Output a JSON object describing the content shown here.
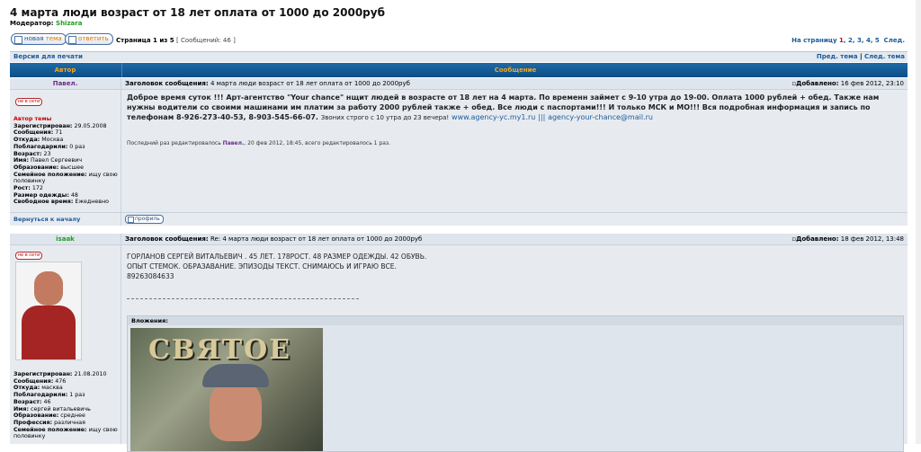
{
  "page": {
    "title": "4 марта люди возраст от 18 лет оплата от 1000 до 2000руб",
    "moderator_label": "Модератор:",
    "moderator_name": "Shizara"
  },
  "toolbar": {
    "new_topic_prefix": "новая",
    "new_topic_suffix": "тема",
    "reply_label": "ответить",
    "page_label": "Страница 1 из 5",
    "messages_count": "[ Сообщений: 46 ]",
    "goto_label": "На страницу",
    "pages": [
      "1",
      "2",
      "3",
      "4",
      "5"
    ],
    "next_label": "След."
  },
  "nav": {
    "print_version": "Версия для печати",
    "prev_topic": "Пред. тема",
    "separator": "|",
    "next_topic": "След. тема"
  },
  "table_header": {
    "author": "Автор",
    "message": "Сообщение"
  },
  "posts": [
    {
      "author": "Павел.",
      "online_label": "не в сети",
      "topic_starter": "Автор темы",
      "subject_label": "Заголовок сообщения:",
      "subject": "4 марта люди возраст от 18 лет оплата от 1000 до 2000руб",
      "added_label": "Добавлено:",
      "added": "16 фев 2012, 23:10",
      "profile": [
        {
          "k": "Зарегистрирован:",
          "v": "29.05.2008"
        },
        {
          "k": "Сообщения:",
          "v": "71"
        },
        {
          "k": "Откуда:",
          "v": "Москва"
        },
        {
          "k": "Поблагодарили:",
          "v": "0 раз"
        },
        {
          "k": "Возраст:",
          "v": "23"
        },
        {
          "k": "Имя:",
          "v": "Павел Сергеевич"
        },
        {
          "k": "Образование:",
          "v": "высшее"
        },
        {
          "k": "Семейное положение:",
          "v": "ищу свою половинку"
        },
        {
          "k": "Рост:",
          "v": "172"
        },
        {
          "k": "Размер одежды:",
          "v": "48"
        },
        {
          "k": "Свободное время:",
          "v": "Ежедневно"
        }
      ],
      "body_main": "Доброе время суток !!! Арт-агентство \"Your chance\" нщит людей в возрасте от 18 лет на 4 марта. По временн займет с 9-10 утра до 19-00. Оплата 1000 рублей + обед. Также нам нужны водители со своими машинами им платим за работу 2000 рублей также + обед. Все люди с паспортами!!! И только МСК и МО!!! Вся подробная информация и запись по телефонам 8-926-273-40-53, 8-903-545-66-07.",
      "body_tail": "Звоних строго с 10 утра до 23 вечера!",
      "link1": "www.agency-yc.my1.ru",
      "link_sep": "|||",
      "link2": "agency-your-chance@mail.ru",
      "edited_prefix": "Последний раз редактировалось",
      "edited_by": "Павел.",
      "edited_suffix": "20 фев 2012, 18:45, всего редактировалось 1 раз.",
      "back_to_top": "Вернуться к началу",
      "profile_button": "профиль"
    },
    {
      "author": "isaak",
      "online_label": "не в сети",
      "subject_label": "Заголовок сообщения:",
      "subject": "Re: 4 марта люди возраст от 18 лет оплата от 1000 до 2000руб",
      "added_label": "Добавлено:",
      "added": "18 фев 2012, 13:48",
      "profile": [
        {
          "k": "Зарегистрирован:",
          "v": "21.08.2010"
        },
        {
          "k": "Сообщения:",
          "v": "476"
        },
        {
          "k": "Откуда:",
          "v": "масква"
        },
        {
          "k": "Поблагодарили:",
          "v": "1 раз"
        },
        {
          "k": "Возраст:",
          "v": "46"
        },
        {
          "k": "Имя:",
          "v": "сергей витальевичь"
        },
        {
          "k": "Образование:",
          "v": "среднее"
        },
        {
          "k": "Профессия:",
          "v": "различная"
        },
        {
          "k": "Семейное положение:",
          "v": "ищу свою половинку"
        }
      ],
      "body_lines": [
        "ГОРЛАНОВ СЕРГЕЙ ВИТАЛЬЕВИЧ . 45 ЛЕТ. 178РОСТ. 48 РАЗМЕР ОДЕЖДЫ. 42 ОБУВЬ.",
        "ОПЫТ СТЕМОК. ОБРАЗАВАНИЕ. ЭПИЗОДЫ ТЕКСТ. СНИМАЮСЬ И ИГРАЮ ВСЕ.",
        "89263084633"
      ],
      "attachments_label": "Вложения:",
      "attachment_word": "СВЯТОЕ"
    }
  ]
}
